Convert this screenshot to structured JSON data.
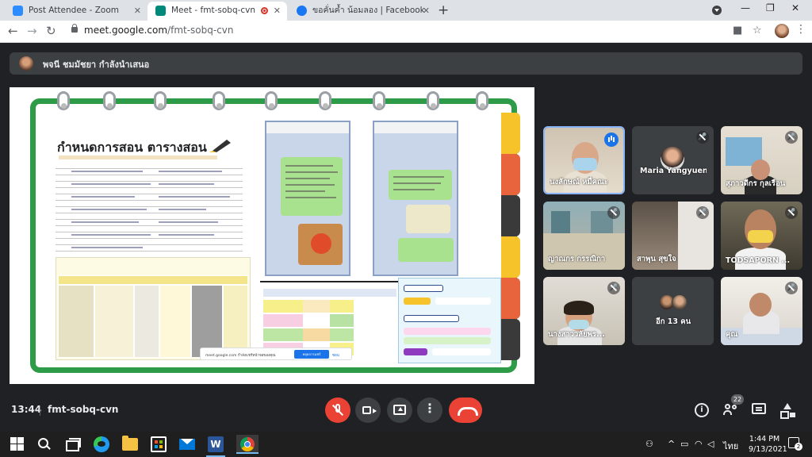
{
  "browser": {
    "tabs": [
      {
        "title": "Post Attendee - Zoom",
        "favicon_color": "#2d8cff"
      },
      {
        "title": "Meet - fmt-sobq-cvn",
        "favicon_color": "#00897b"
      },
      {
        "title": "ขอคั่นค้ำ น้อมลอง | Facebook",
        "favicon_color": "#1877f2"
      }
    ],
    "new_tab": "+",
    "address": {
      "host": "meet.google.com",
      "path": "/fmt-sobq-cvn"
    }
  },
  "presenter": {
    "label": "พจนี ชมมัชยา กำลังนำเสนอ"
  },
  "slide": {
    "title": "กำหนดการสอน  ตารางสอน",
    "share_notice": {
      "text": "meet.google.com กำลังแชร์หน้าจอของคุณ",
      "stop": "หยุดการแชร์",
      "hide": "ซ่อน"
    }
  },
  "participants": [
    {
      "name": "นงลักษณ์ หมื่คณะ",
      "speaking": true
    },
    {
      "name": "Maria Yangyuen",
      "muted": true
    },
    {
      "name": "สุภาวดีกร กุลเรือน",
      "muted": true
    },
    {
      "name": "ญาณกร กรรณิกา",
      "muted": true
    },
    {
      "name": "สาพุน สุขใจ",
      "muted": true
    },
    {
      "name": "TODSAPORN ...",
      "muted": true
    },
    {
      "name": "นางสาววลัยพร...",
      "muted": true
    },
    {
      "name": "อีก 13 คน"
    },
    {
      "name": "คุณ",
      "muted": true
    }
  ],
  "bottom_bar": {
    "time": "13:44",
    "meeting_code": "fmt-sobq-cvn",
    "people_count": "22"
  },
  "taskbar": {
    "word_label": "W",
    "clock_time": "1:44 PM",
    "clock_date": "9/13/2021",
    "language": "ไทย",
    "notification_count": "2"
  },
  "colors": {
    "binder_green": "#2e9b48",
    "meet_red": "#ea4335",
    "speaking_blue": "#8ab4f8",
    "meet_dark": "#202124"
  }
}
